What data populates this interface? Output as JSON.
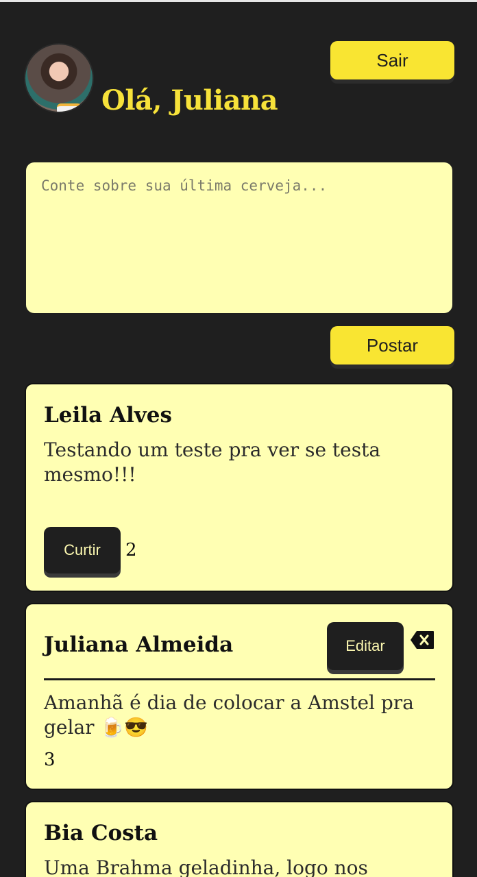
{
  "header": {
    "greeting": "Olá, Juliana",
    "logout_label": "Sair"
  },
  "composer": {
    "placeholder": "Conte sobre sua última cerveja...",
    "post_label": "Postar"
  },
  "posts": [
    {
      "author": "Leila Alves",
      "text": "Testando um teste pra ver se testa mesmo!!!",
      "like_label": "Curtir",
      "likes": "2"
    },
    {
      "author": "Juliana Almeida",
      "text": "Amanhã é dia de colocar a Amstel pra gelar 🍺😎",
      "edit_label": "Editar",
      "likes": "3"
    },
    {
      "author": "Bia Costa",
      "text": "Uma Brahma geladinha, logo nos"
    }
  ],
  "icons": {
    "avatar": "user-photo",
    "delete": "backspace-delete-icon"
  },
  "colors": {
    "background": "#1f1f1f",
    "accent_yellow": "#f9e532",
    "card_bg": "#ffffb3"
  }
}
